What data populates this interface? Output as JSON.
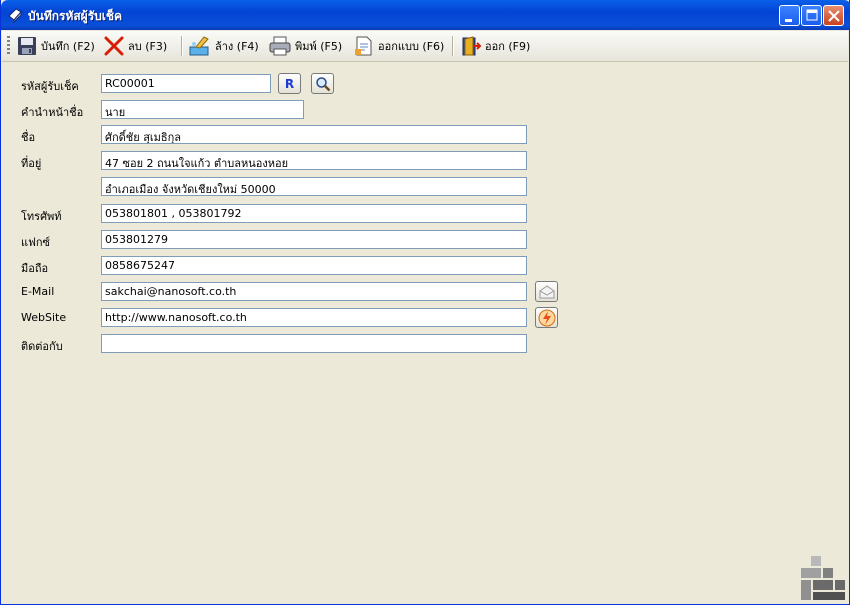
{
  "window": {
    "title": "บันทึกรหัสผู้รับเช็ค"
  },
  "toolbar": {
    "save": "บันทึก (F2)",
    "delete": "ลบ (F3)",
    "clear": "ล้าง (F4)",
    "print": "พิมพ์ (F5)",
    "design": "ออกแบบ (F6)",
    "exit": "ออก (F9)"
  },
  "form": {
    "code_label": "รหัสผู้รับเช็ค",
    "code_value": "RC00001",
    "r_button": "R",
    "prefix_label": "คำนำหน้าชื่อ",
    "prefix_value": "นาย",
    "name_label": "ชื่อ",
    "name_value": "ศักดิ์ชัย  สุเมธิกุล",
    "address_label": "ที่อยู่",
    "address1_value": "47 ซอย 2 ถนนใจแก้ว ตำบลหนองหอย",
    "address2_value": "อำเภอเมือง  จังหวัดเชียงใหม่  50000",
    "phone_label": "โทรศัพท์",
    "phone_value": "053801801 , 053801792",
    "fax_label": "แฟกซ์",
    "fax_value": "053801279",
    "mobile_label": "มือถือ",
    "mobile_value": "0858675247",
    "email_label": "E-Mail",
    "email_value": "sakchai@nanosoft.co.th",
    "website_label": "WebSite",
    "website_value": "http://www.nanosoft.co.th",
    "contact_label": "ติดต่อกับ",
    "contact_value": ""
  }
}
